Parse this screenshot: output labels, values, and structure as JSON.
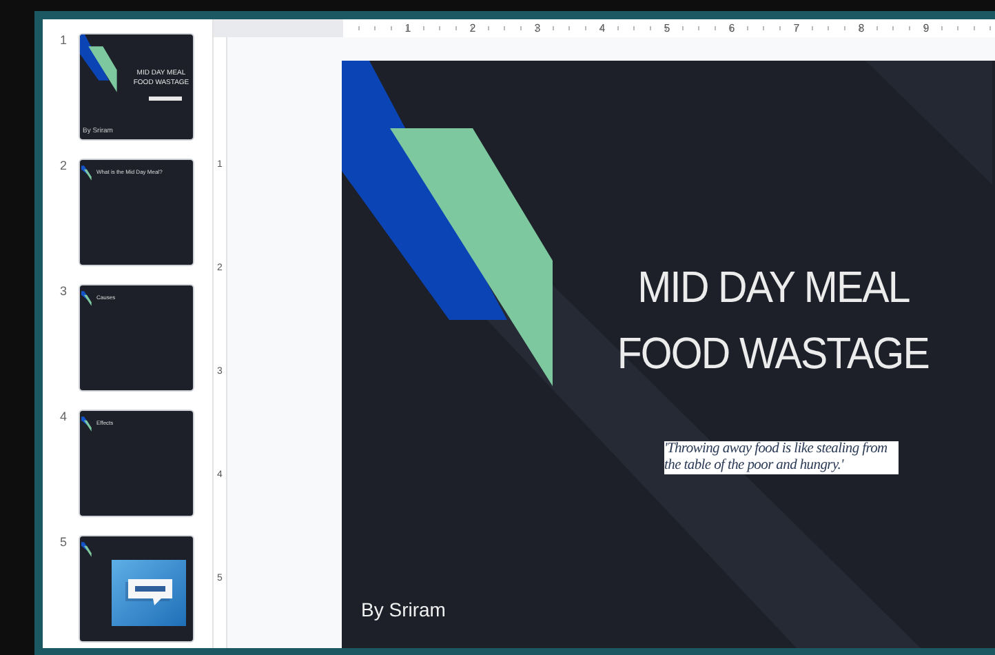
{
  "filmstrip": [
    {
      "number": "1",
      "kind": "title",
      "title_lines": [
        "MID DAY MEAL",
        "FOOD WASTAGE"
      ],
      "footer": "By Sriram"
    },
    {
      "number": "2",
      "kind": "heading",
      "heading": "What is the Mid Day Meal?"
    },
    {
      "number": "3",
      "kind": "heading",
      "heading": "Causes"
    },
    {
      "number": "4",
      "kind": "heading",
      "heading": "Effects"
    },
    {
      "number": "5",
      "kind": "picture"
    }
  ],
  "rulers": {
    "horizontal": [
      "1",
      "2",
      "3",
      "4",
      "5",
      "6",
      "7",
      "8",
      "9"
    ],
    "vertical": [
      "1",
      "2",
      "3",
      "4",
      "5"
    ]
  },
  "slide": {
    "title_lines": [
      "MID DAY MEAL",
      "FOOD WASTAGE"
    ],
    "quote": "'Throwing away food is like stealing from the table of the poor and hungry.'",
    "author": "By Sriram"
  }
}
